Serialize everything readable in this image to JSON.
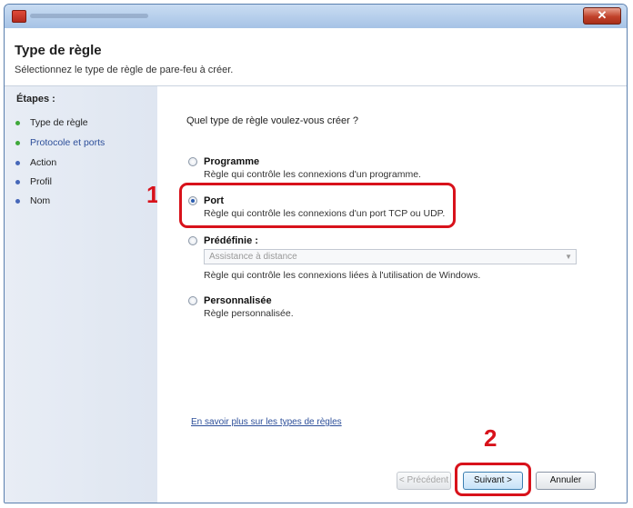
{
  "window": {
    "title": ""
  },
  "header": {
    "title": "Type de règle",
    "subtitle": "Sélectionnez le type de règle de pare-feu à créer."
  },
  "sidebar": {
    "steps_label": "Étapes :",
    "steps": [
      {
        "label": "Type de règle",
        "status": "current",
        "dot_color": "#3fa83a"
      },
      {
        "label": "Protocole et ports",
        "status": "link",
        "dot_color": "#3fa83a"
      },
      {
        "label": "Action",
        "status": "pending",
        "dot_color": "#4667b9"
      },
      {
        "label": "Profil",
        "status": "pending",
        "dot_color": "#4667b9"
      },
      {
        "label": "Nom",
        "status": "pending",
        "dot_color": "#4667b9"
      }
    ]
  },
  "main": {
    "question": "Quel type de règle voulez-vous créer ?",
    "options": [
      {
        "title": "Programme",
        "description": "Règle qui contrôle les connexions d'un programme.",
        "selected": false
      },
      {
        "title": "Port",
        "description": "Règle qui contrôle les connexions d'un port TCP ou UDP.",
        "selected": true
      },
      {
        "title": "Prédéfinie :",
        "description": "Règle qui contrôle les connexions liées à l'utilisation de Windows.",
        "selected": false,
        "dropdown_value": "Assistance à distance"
      },
      {
        "title": "Personnalisée",
        "description": "Règle personnalisée.",
        "selected": false
      }
    ],
    "learn_more": "En savoir plus sur les types de règles"
  },
  "annotations": {
    "callout_1": "1",
    "callout_2": "2",
    "highlight_color": "#d8121b"
  },
  "buttons": {
    "previous": "< Précédent",
    "next": "Suivant >",
    "cancel": "Annuler"
  }
}
